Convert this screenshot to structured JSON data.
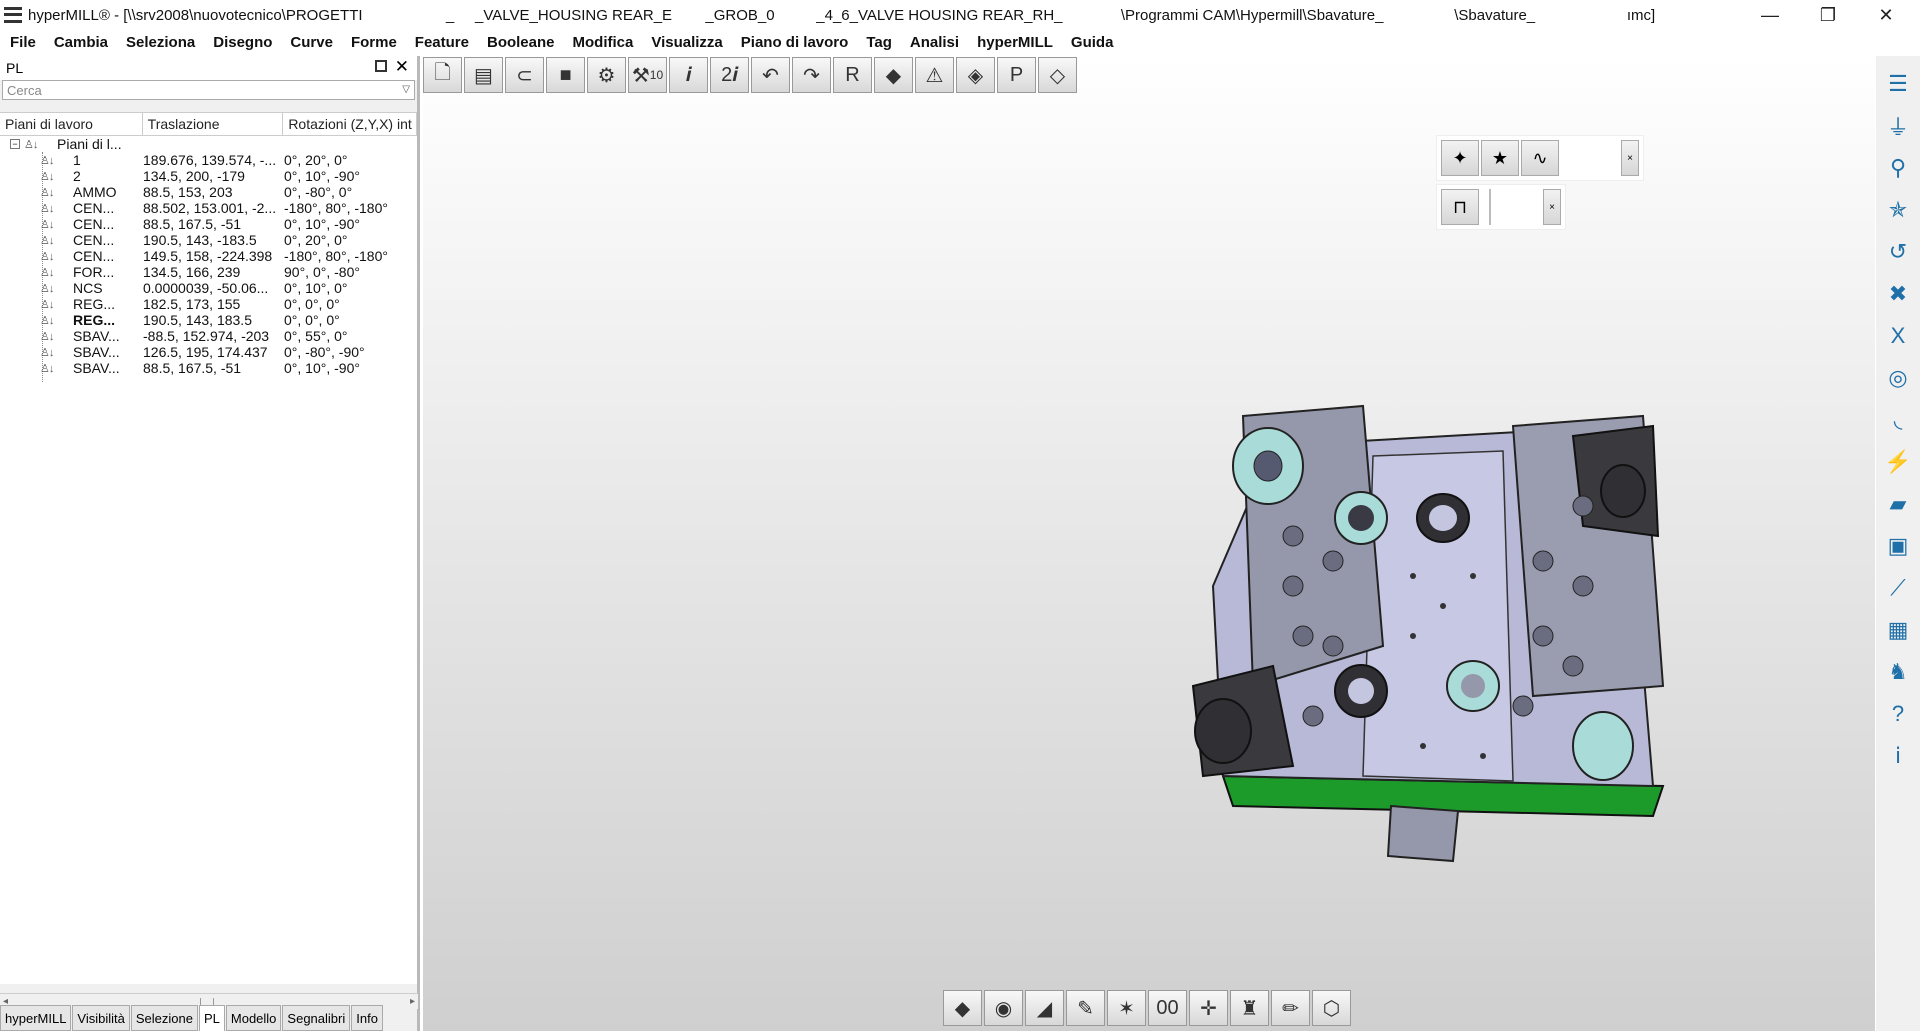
{
  "window": {
    "title": "hyperMILL® - [\\\\srv2008\\nuovotecnico\\PROGETTI                    _     _VALVE_HOUSING REAR_E        _GROB_0          _4_6_VALVE HOUSING REAR_RH_              \\Programmi CAM\\Hypermill\\Sbavature_                 \\Sbavature_                      ımc]",
    "min_glyph": "—",
    "max_glyph": "❐",
    "close_glyph": "✕"
  },
  "menu": [
    "File",
    "Cambia",
    "Seleziona",
    "Disegno",
    "Curve",
    "Forme",
    "Feature",
    "Booleane",
    "Modifica",
    "Visualizza",
    "Piano di lavoro",
    "Tag",
    "Analisi",
    "hyperMILL",
    "Guida"
  ],
  "panel": {
    "title": "PL",
    "close_glyph": "✕",
    "search_placeholder": "Cerca",
    "columns": [
      "Piani di lavoro",
      "Traslazione",
      "Rotazioni (Z,Y,X) int"
    ],
    "root_label": "Piani di l...",
    "rows": [
      {
        "name": "1",
        "trans": "189.676, 139.574, -...",
        "rot": "0°, 20°, 0°",
        "bold": false
      },
      {
        "name": "2",
        "trans": "134.5, 200, -179",
        "rot": "0°, 10°, -90°",
        "bold": false
      },
      {
        "name": "AMMO",
        "trans": "88.5, 153, 203",
        "rot": "0°, -80°, 0°",
        "bold": false
      },
      {
        "name": "CEN...",
        "trans": "88.502, 153.001, -2...",
        "rot": "-180°, 80°, -180°",
        "bold": false
      },
      {
        "name": "CEN...",
        "trans": "88.5, 167.5, -51",
        "rot": "0°, 10°, -90°",
        "bold": false
      },
      {
        "name": "CEN...",
        "trans": "190.5, 143, -183.5",
        "rot": "0°, 20°, 0°",
        "bold": false
      },
      {
        "name": "CEN...",
        "trans": "149.5, 158, -224.398",
        "rot": "-180°, 80°, -180°",
        "bold": false
      },
      {
        "name": "FOR...",
        "trans": "134.5, 166, 239",
        "rot": "90°, 0°, -80°",
        "bold": false
      },
      {
        "name": "NCS",
        "trans": "0.0000039, -50.06...",
        "rot": "0°, 10°, 0°",
        "bold": false
      },
      {
        "name": "REG...",
        "trans": "182.5, 173, 155",
        "rot": "0°, 0°, 0°",
        "bold": false
      },
      {
        "name": "REG...",
        "trans": "190.5, 143, 183.5",
        "rot": "0°, 0°, 0°",
        "bold": true
      },
      {
        "name": "SBAV...",
        "trans": "-88.5, 152.974, -203",
        "rot": "0°, 55°, 0°",
        "bold": false
      },
      {
        "name": "SBAV...",
        "trans": "126.5, 195, 174.437",
        "rot": "0°, -80°, -90°",
        "bold": false
      },
      {
        "name": "SBAV...",
        "trans": "88.5, 167.5, -51",
        "rot": "0°, 10°, -90°",
        "bold": false
      }
    ],
    "tabs": [
      "hyperMILL",
      "Visibilità",
      "Selezione",
      "PL",
      "Modello",
      "Segnalibri",
      "Info"
    ],
    "active_tab": "PL"
  },
  "top_toolbar": [
    {
      "icon": "new-document-icon",
      "glyph": "🗋"
    },
    {
      "icon": "open-box-icon",
      "glyph": "▤"
    },
    {
      "icon": "magnet-icon",
      "glyph": "⊂"
    },
    {
      "icon": "gift-box-icon",
      "glyph": "■"
    },
    {
      "icon": "gear-icon",
      "glyph": "⚙"
    },
    {
      "icon": "tool-10-icon",
      "glyph": "⚒",
      "sub": "10"
    },
    {
      "icon": "info-i-icon",
      "glyph": "𝒊"
    },
    {
      "icon": "info-2i-icon",
      "glyph": "2𝒊"
    },
    {
      "icon": "undo-icon",
      "glyph": "↶"
    },
    {
      "icon": "redo-icon",
      "glyph": "↷"
    },
    {
      "icon": "reset-r-icon",
      "glyph": "R"
    },
    {
      "icon": "solid-cube-icon",
      "glyph": "◆"
    },
    {
      "icon": "warning-icon",
      "glyph": "⚠"
    },
    {
      "icon": "boolean-cube-icon",
      "glyph": "◈"
    },
    {
      "icon": "parking-p-icon",
      "glyph": "P"
    },
    {
      "icon": "diamond-icon",
      "glyph": "◇"
    }
  ],
  "bottom_toolbar": [
    {
      "icon": "layers-icon",
      "glyph": "◆"
    },
    {
      "icon": "shading-icon",
      "glyph": "◉"
    },
    {
      "icon": "plane-icon",
      "glyph": "◢"
    },
    {
      "icon": "pen-plane-icon",
      "glyph": "✎"
    },
    {
      "icon": "star-pin-icon",
      "glyph": "✶"
    },
    {
      "icon": "zero-zero-icon",
      "glyph": "00"
    },
    {
      "icon": "axis-yellow-icon",
      "glyph": "✛"
    },
    {
      "icon": "fixture-icon",
      "glyph": "♜"
    },
    {
      "icon": "pencil-icon",
      "glyph": "✏"
    },
    {
      "icon": "wireframe-cube-icon",
      "glyph": "⬡"
    }
  ],
  "palette1": [
    {
      "icon": "feature-green-icon",
      "glyph": "✦"
    },
    {
      "icon": "feature-star-icon",
      "glyph": "★"
    },
    {
      "icon": "feature-wave-icon",
      "glyph": "∿"
    }
  ],
  "palette2": [
    {
      "icon": "contour-tool-icon",
      "glyph": "⊓"
    }
  ],
  "right_toolbar": [
    {
      "icon": "stack-icon",
      "glyph": "☰"
    },
    {
      "icon": "funnel-icon",
      "glyph": "⏚"
    },
    {
      "icon": "pin-drop-icon",
      "glyph": "⚲"
    },
    {
      "icon": "star-list-icon",
      "glyph": "✯"
    },
    {
      "icon": "hook-icon",
      "glyph": "↺"
    },
    {
      "icon": "cross-tool-icon",
      "glyph": "✖"
    },
    {
      "icon": "excel-icon",
      "glyph": "X"
    },
    {
      "icon": "tool-ring-icon",
      "glyph": "◎"
    },
    {
      "icon": "curve-surface-icon",
      "glyph": "◟"
    },
    {
      "icon": "drill-icon",
      "glyph": "⚡"
    },
    {
      "icon": "folder-red-icon",
      "glyph": "▰"
    },
    {
      "icon": "machine-icon",
      "glyph": "▣"
    },
    {
      "icon": "knife-icon",
      "glyph": "⟋"
    },
    {
      "icon": "grid-icon",
      "glyph": "▦"
    },
    {
      "icon": "robot-arm-icon",
      "glyph": "♞"
    },
    {
      "icon": "help-icon",
      "glyph": "?"
    },
    {
      "icon": "info-stack-icon",
      "glyph": "ⅰ"
    }
  ]
}
